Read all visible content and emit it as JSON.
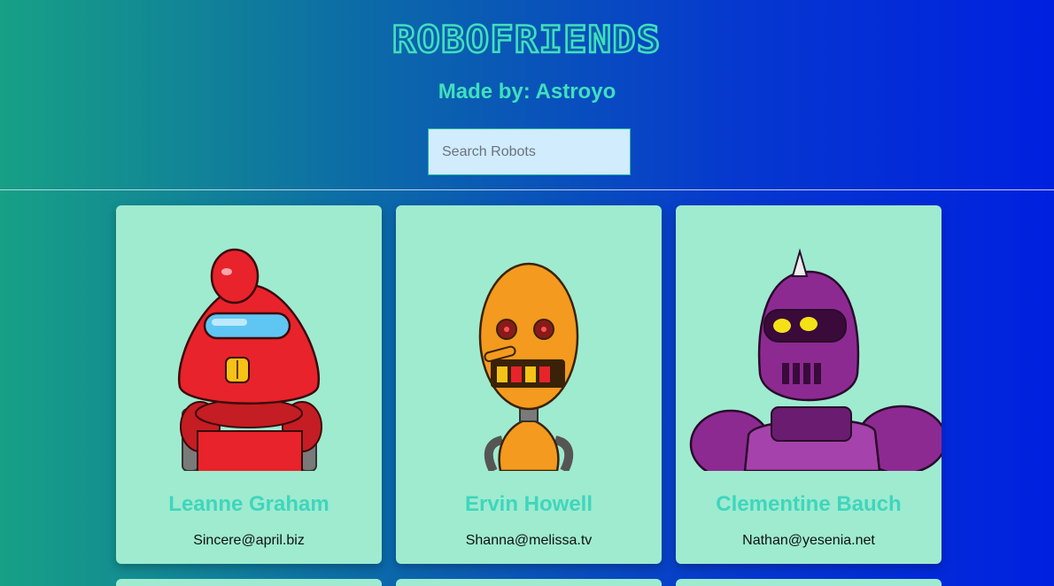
{
  "app": {
    "logo": "ROBOFRIENDS",
    "subtitle": "Made by: Astroyo"
  },
  "search": {
    "placeholder": "Search Robots",
    "value": ""
  },
  "robots": [
    {
      "name": "Leanne Graham",
      "email": "Sincere@april.biz",
      "color": "#e8232b"
    },
    {
      "name": "Ervin Howell",
      "email": "Shanna@melissa.tv",
      "color": "#f39a1f"
    },
    {
      "name": "Clementine Bauch",
      "email": "Nathan@yesenia.net",
      "color": "#8c2a92"
    }
  ],
  "colors": {
    "card_bg": "#9eebd0",
    "accent": "#3fe0bd",
    "search_bg": "#d0ecfd"
  }
}
